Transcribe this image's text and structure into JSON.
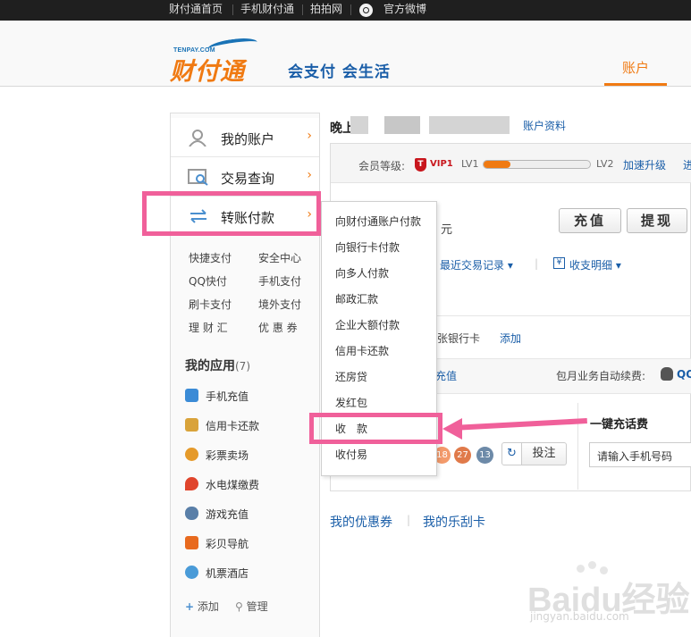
{
  "topnav": {
    "items": [
      "财付通首页",
      "手机财付通",
      "拍拍网",
      "官方微博"
    ]
  },
  "header": {
    "logo_small": "TENPAY.COM",
    "logo_main": "财付通",
    "slogan": "会支付 会生活",
    "account_tab": "账户"
  },
  "sidebar": {
    "menu": [
      {
        "label": "我的账户",
        "icon": "user-icon"
      },
      {
        "label": "交易查询",
        "icon": "search-doc-icon"
      },
      {
        "label": "转账付款",
        "icon": "transfer-icon"
      }
    ],
    "arrow": "›",
    "quick_links": [
      "快捷支付",
      "安全中心",
      "QQ快付",
      "手机支付",
      "刷卡支付",
      "境外支付",
      "理 财 汇",
      "优 惠 券"
    ],
    "apps_title": "我的应用",
    "apps_count": "(7)",
    "apps": [
      {
        "label": "手机充值",
        "icon": "phone-charge-icon",
        "color": "#3b8bd6"
      },
      {
        "label": "信用卡还款",
        "icon": "credit-card-icon",
        "color": "#d9a33a"
      },
      {
        "label": "彩票卖场",
        "icon": "lottery-icon",
        "color": "#e59a2a"
      },
      {
        "label": "水电煤缴费",
        "icon": "flame-icon",
        "color": "#e0452c"
      },
      {
        "label": "游戏充值",
        "icon": "gamepad-icon",
        "color": "#5a7fa8"
      },
      {
        "label": "彩贝导航",
        "icon": "shell-icon",
        "color": "#e86a1e"
      },
      {
        "label": "机票酒店",
        "icon": "plane-icon",
        "color": "#4a9bd8"
      }
    ],
    "add_label": "添加",
    "manage_label": "管理"
  },
  "main": {
    "greeting": "晚上",
    "account_info_link": "账户资料",
    "member_level_label": "会员等级:",
    "vip_badge": "VIP1",
    "lv1": "LV1",
    "lv2": "LV2",
    "level_progress": 0.25,
    "upgrade_link": "加速升级",
    "upgrade_link2": "进",
    "currency_unit": "元",
    "recharge_button": "充值",
    "withdraw_button": "提现",
    "recent_trades": "最近交易记录 ▾",
    "detail_icon": "¥",
    "income_detail": "收支明细 ▾",
    "bank_card_text": "张银行卡",
    "add_bank_link": "添加",
    "recharge_link": "充值",
    "monthly_renew": "包月业务自动续费:",
    "qq_trunc": "QQ",
    "lottery_balls": [
      "18",
      "27",
      "13"
    ],
    "refresh_icon": "↻",
    "bet_button": "投注",
    "one_click_recharge": "一键充话费",
    "phone_placeholder": "请输入手机号码",
    "my_coupons": "我的优惠券",
    "scratch_card": "我的乐刮卡",
    "sep": "|"
  },
  "dropdown": {
    "items": [
      "向财付通账户付款",
      "向银行卡付款",
      "向多人付款",
      "邮政汇款",
      "企业大额付款",
      "信用卡还款",
      "还房贷",
      "发红包",
      "收　款",
      "收付易"
    ]
  },
  "watermark": {
    "main": "Baidu经验",
    "sub": "jingyan.baidu.com"
  }
}
